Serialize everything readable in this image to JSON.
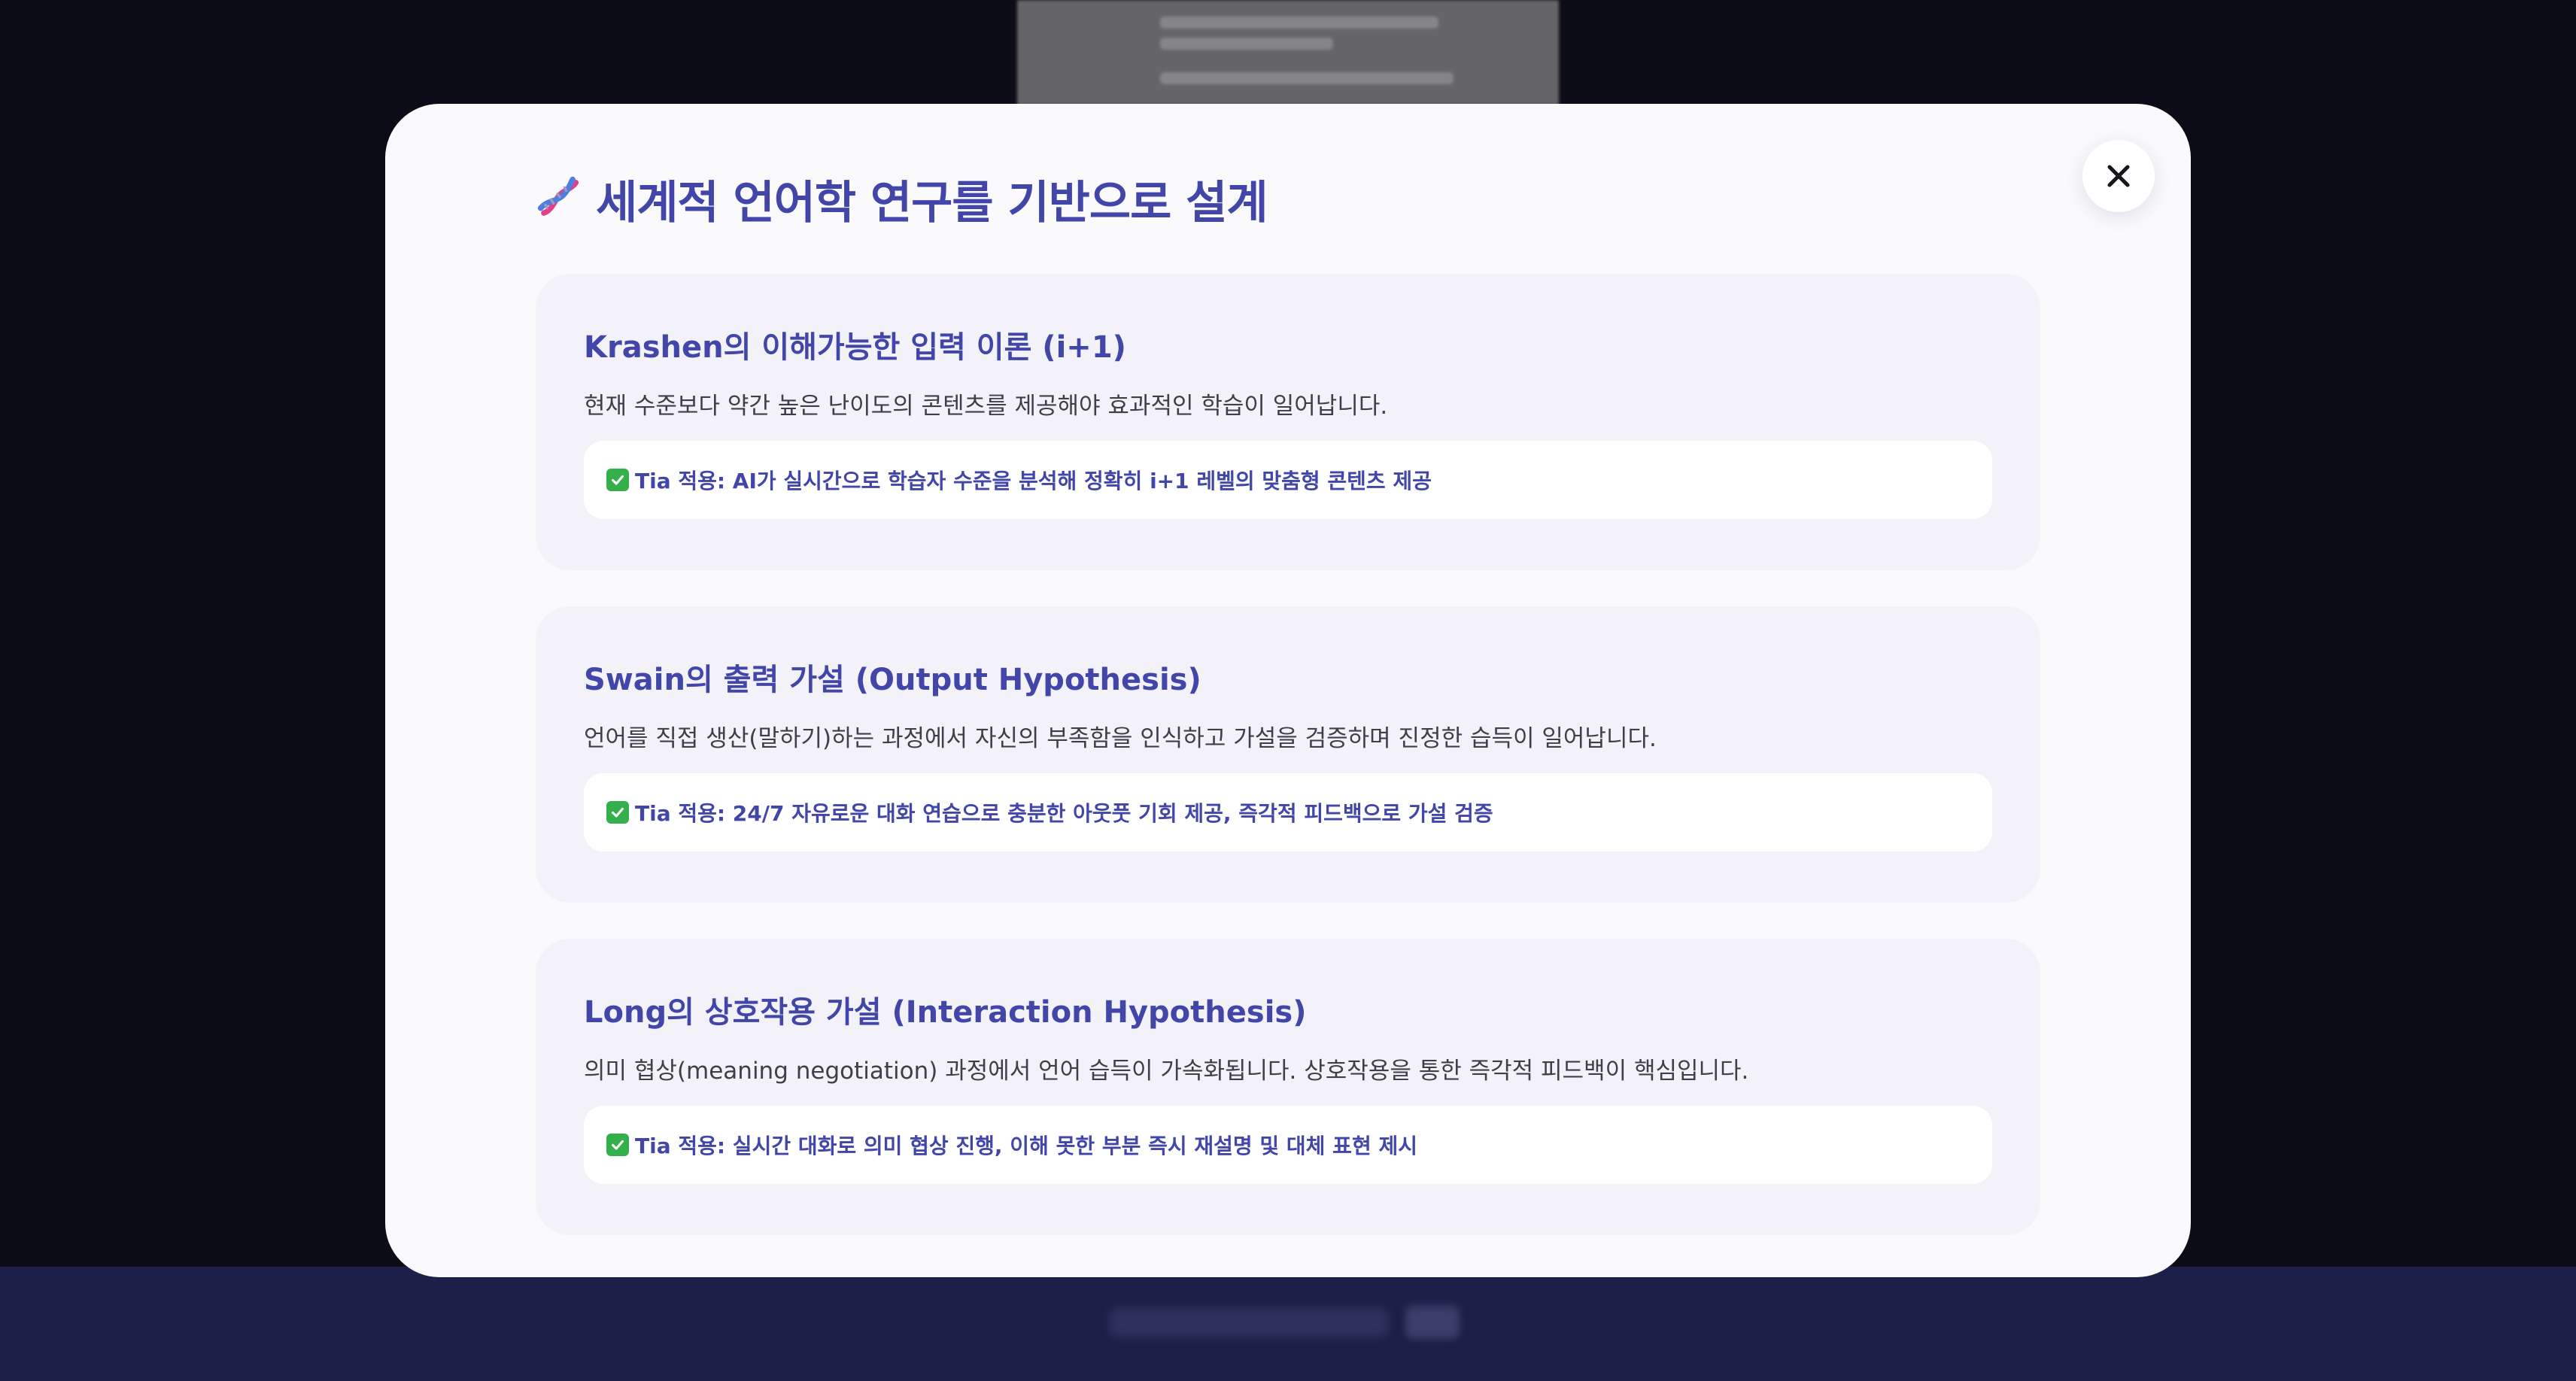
{
  "modal": {
    "title": "세계적 언어학 연구를 기반으로 설계",
    "title_icon": "dna-icon",
    "close_icon": "close-icon"
  },
  "cards": [
    {
      "title": "Krashen의 이해가능한 입력 이론 (i+1)",
      "description": "현재 수준보다 약간 높은 난이도의 콘텐츠를 제공해야 효과적인 학습이 일어납니다.",
      "apply": "Tia 적용: AI가 실시간으로 학습자 수준을 분석해 정확히 i+1 레벨의 맞춤형 콘텐츠 제공"
    },
    {
      "title": "Swain의 출력 가설 (Output Hypothesis)",
      "description": "언어를 직접 생산(말하기)하는 과정에서 자신의 부족함을 인식하고 가설을 검증하며 진정한 습득이 일어납니다.",
      "apply": "Tia 적용: 24/7 자유로운 대화 연습으로 충분한 아웃풋 기회 제공, 즉각적 피드백으로 가설 검증"
    },
    {
      "title": "Long의 상호작용 가설 (Interaction Hypothesis)",
      "description": "의미 협상(meaning negotiation) 과정에서 언어 습득이 가속화됩니다. 상호작용을 통한 즉각적 피드백이 핵심입니다.",
      "apply": "Tia 적용: 실시간 대화로 의미 협상 진행, 이해 못한 부분 즉시 재설명 및 대체 표현 제시"
    }
  ],
  "colors": {
    "accent": "#4146a8",
    "check": "#34b04a",
    "card_bg": "#f2f2f8",
    "overlay": "#0b0c18",
    "footer": "#1c1f47"
  }
}
